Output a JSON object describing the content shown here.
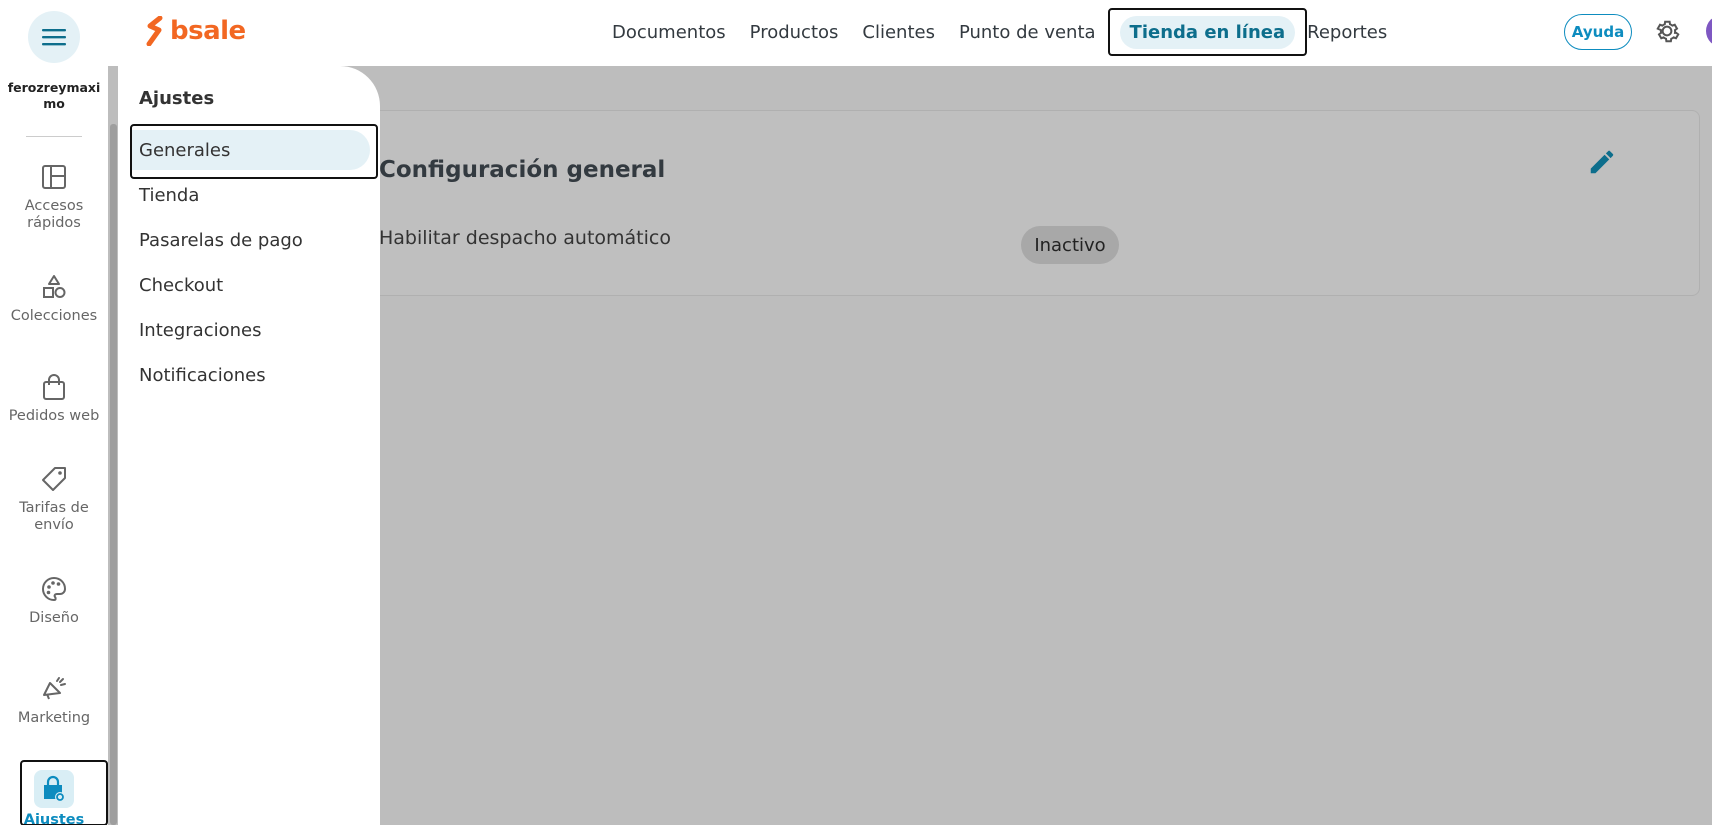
{
  "header": {
    "logo_text": "bsale",
    "nav": [
      {
        "label": "Documentos"
      },
      {
        "label": "Productos"
      },
      {
        "label": "Clientes"
      },
      {
        "label": "Punto de venta"
      },
      {
        "label": "Tienda en línea",
        "active": true
      },
      {
        "label": "Reportes"
      }
    ],
    "help_label": "Ayuda",
    "icons": {
      "menu": "hamburger-menu-icon",
      "settings": "gear-icon",
      "avatar": "user-avatar"
    }
  },
  "rail": {
    "store_name": "ferozreymaximo",
    "items": [
      {
        "label": "Accesos rápidos",
        "icon": "layout-panels-icon"
      },
      {
        "label": "Colecciones",
        "icon": "shapes-icon"
      },
      {
        "label": "Pedidos web",
        "icon": "shopping-bag-icon"
      },
      {
        "label": "Tarifas de envío",
        "icon": "tag-icon"
      },
      {
        "label": "Diseño",
        "icon": "palette-icon"
      },
      {
        "label": "Marketing",
        "icon": "megaphone-icon"
      },
      {
        "label": "Ajustes",
        "icon": "bag-gear-icon",
        "active": true
      }
    ]
  },
  "submenu": {
    "title": "Ajustes",
    "items": [
      {
        "label": "Generales",
        "active": true
      },
      {
        "label": "Tienda"
      },
      {
        "label": "Pasarelas de pago"
      },
      {
        "label": "Checkout"
      },
      {
        "label": "Integraciones"
      },
      {
        "label": "Notificaciones"
      }
    ]
  },
  "main": {
    "card_title": "Configuración general",
    "field_label": "Habilitar despacho automático",
    "field_status": "Inactivo",
    "edit_icon": "pencil-icon"
  },
  "colors": {
    "brand_orange": "#f26722",
    "accent_blue": "#0d8cbf",
    "active_text": "#0d6e8c",
    "active_bg": "#e4f1f6",
    "overlay_gray": "#bdbdbd"
  }
}
